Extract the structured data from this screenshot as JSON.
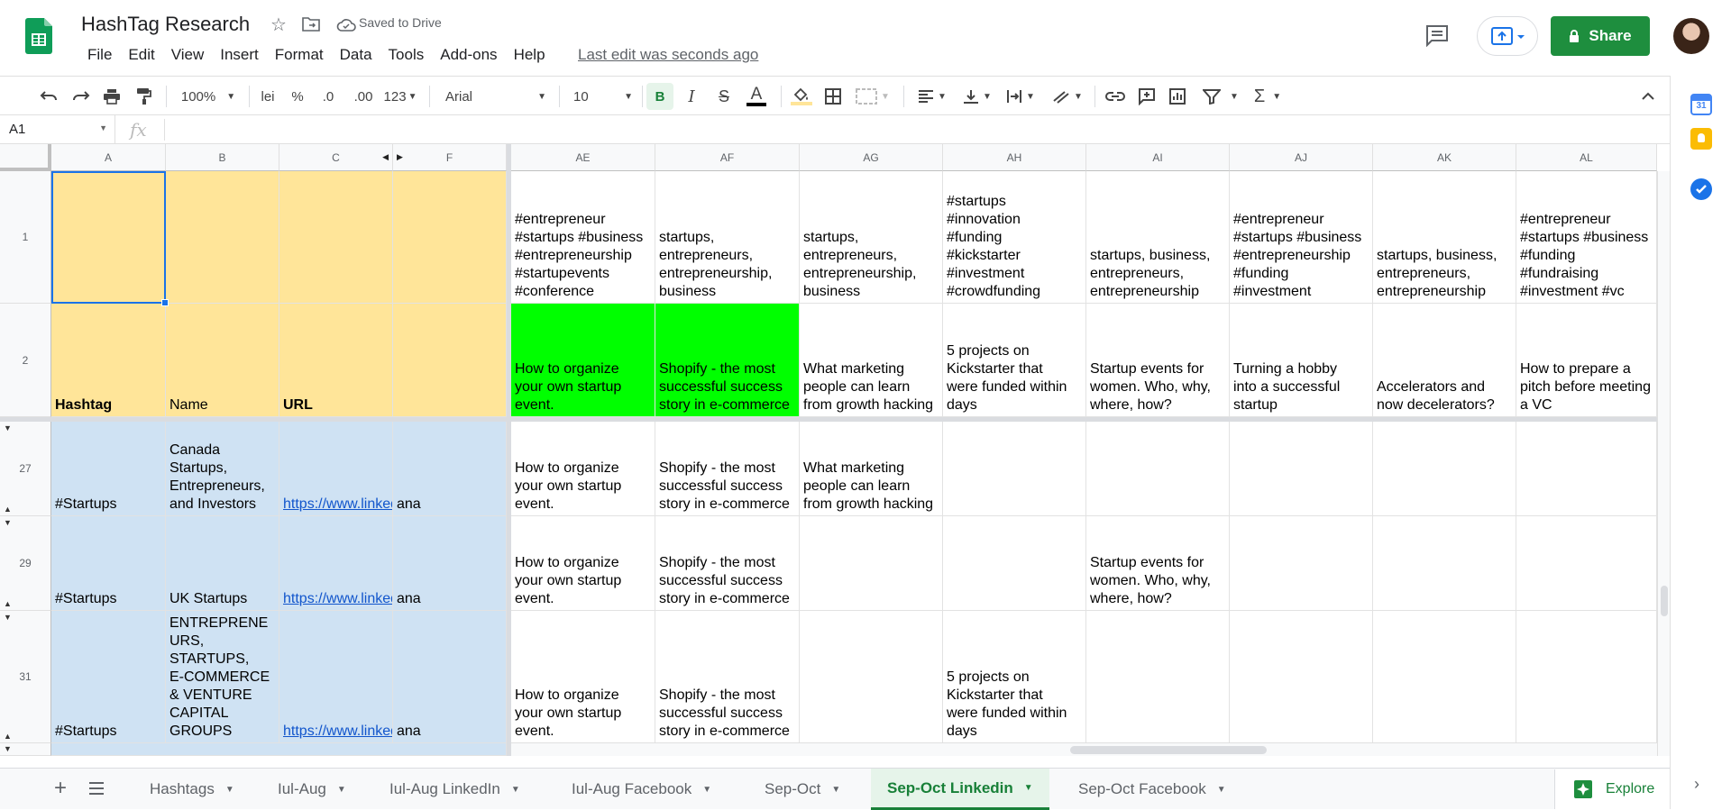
{
  "app": {
    "doc_title": "HashTag Research",
    "saved_status": "Saved to Drive",
    "last_edit": "Last edit was seconds ago",
    "menu": [
      "File",
      "Edit",
      "View",
      "Insert",
      "Format",
      "Data",
      "Tools",
      "Add-ons",
      "Help"
    ],
    "share_label": "Share"
  },
  "toolbar": {
    "zoom": "100%",
    "currency": "lei",
    "percent": "%",
    "dec_decrease": ".0",
    "dec_increase": ".00",
    "more_formats": "123",
    "font": "Arial",
    "font_size": "10",
    "bold": "B",
    "italic": "I",
    "strike": "S",
    "text_color": "A"
  },
  "formula_bar": {
    "name_box": "A1",
    "fx": "fx",
    "value": ""
  },
  "grid": {
    "columns": [
      "A",
      "B",
      "C",
      "F",
      "AE",
      "AF",
      "AG",
      "AH",
      "AI",
      "AJ",
      "AK",
      "AL"
    ],
    "rows": [
      {
        "num": "1",
        "cells": [
          "",
          "",
          "",
          "",
          "#entrepreneur\n#startups #business\n#entrepreneurship\n#startupevents\n#conference",
          "startups,\nentrepreneurs,\nentrepreneurship,\nbusiness",
          "startups,\nentrepreneurs,\nentrepreneurship,\nbusiness",
          "#startups\n#innovation\n#funding\n#kickstarter\n#investment\n#crowdfunding",
          "startups, business,\nentrepreneurs,\nentrepreneurship",
          "#entrepreneur\n#startups #business\n#entrepreneurship\n#funding\n#investment",
          "startups, business,\nentrepreneurs,\nentrepreneurship",
          "#entrepreneur\n#startups #business\n#funding\n#fundraising\n#investment #vc"
        ]
      },
      {
        "num": "2",
        "cells": [
          "Hashtag",
          "Name",
          "URL",
          "",
          "How to organize\nyour own startup\nevent.",
          "Shopify - the most\nsuccessful success\nstory in e-commerce",
          "What marketing\npeople can learn\nfrom growth hacking",
          "5 projects on\nKickstarter that\nwere funded within\ndays",
          "Startup events for\nwomen. Who, why,\nwhere, how?",
          "Turning a hobby\ninto a successful\nstartup",
          "Accelerators and\nnow decelerators?",
          "How to prepare a\npitch before meeting\na VC"
        ]
      },
      {
        "num": "27",
        "cells": [
          "#Startups",
          "Canada\nStartups,\nEntrepreneurs,\nand Investors",
          "https://www.linkedin.com",
          "ana",
          "How to organize\nyour own startup\nevent.",
          "Shopify - the most\nsuccessful success\nstory in e-commerce",
          "What marketing\npeople can learn\nfrom growth hacking",
          "",
          "",
          "",
          "",
          ""
        ]
      },
      {
        "num": "29",
        "cells": [
          "#Startups",
          "UK Startups",
          "https://www.linkedin.com",
          "ana",
          "How to organize\nyour own startup\nevent.",
          "Shopify - the most\nsuccessful success\nstory in e-commerce",
          "",
          "",
          "Startup events for\nwomen. Who, why,\nwhere, how?",
          "",
          "",
          ""
        ]
      },
      {
        "num": "31",
        "cells": [
          "#Startups",
          "ENTREPRENE\nURS,\nSTARTUPS,\nE-COMMERCE\n& VENTURE\nCAPITAL\nGROUPS",
          "https://www.linkedin.com",
          "ana",
          "How to organize\nyour own startup\nevent.",
          "Shopify - the most\nsuccessful success\nstory in e-commerce",
          "",
          "5 projects on\nKickstarter that\nwere funded within\ndays",
          "",
          "",
          "",
          ""
        ]
      }
    ]
  },
  "sheets": {
    "tabs": [
      "Hashtags",
      "Iul-Aug",
      "Iul-Aug LinkedIn",
      "Iul-Aug Facebook",
      "Sep-Oct",
      "Sep-Oct Linkedin",
      "Sep-Oct Facebook"
    ],
    "active": "Sep-Oct Linkedin",
    "explore_label": "Explore"
  },
  "side_panel": [
    "calendar-icon",
    "keep-icon",
    "tasks-icon"
  ],
  "colors": {
    "header_yellow": "#ffe599",
    "row_blue": "#cfe2f3",
    "highlight_green": "#00ff00",
    "share_green": "#1e8e3e",
    "selection_blue": "#1a73e8"
  }
}
